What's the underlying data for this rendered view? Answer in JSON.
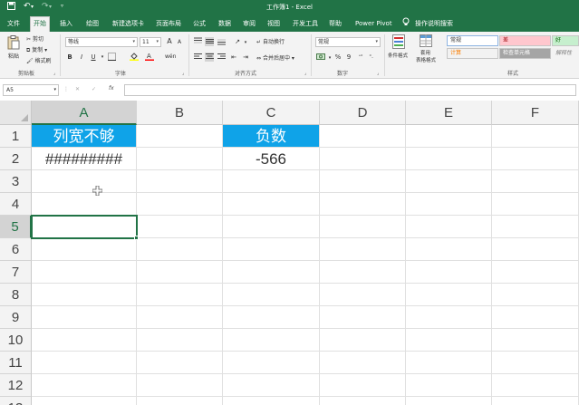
{
  "window": {
    "title": "工作簿1 - Excel",
    "quick_access": [
      "save-icon",
      "undo-icon",
      "redo-icon",
      "customize-icon"
    ]
  },
  "ribbon_tabs": [
    "文件",
    "开始",
    "插入",
    "绘图",
    "新建选项卡",
    "页面布局",
    "公式",
    "数据",
    "审阅",
    "视图",
    "开发工具",
    "帮助",
    "Power Pivot"
  ],
  "active_tab": "开始",
  "tell_me": "操作说明搜索",
  "ribbon": {
    "clipboard": {
      "paste": "粘贴",
      "cut": "剪切",
      "copy": "复制",
      "format_painter": "格式刷",
      "label": "剪贴板"
    },
    "font": {
      "name": "等线",
      "size": "11",
      "grow": "A",
      "shrink": "A",
      "bold": "B",
      "italic": "I",
      "underline": "U",
      "phonetic": "wén",
      "label": "字体"
    },
    "alignment": {
      "wrap_text": "自动换行",
      "merge_center": "合并后居中",
      "label": "对齐方式"
    },
    "number": {
      "format": "常规",
      "percent": "%",
      "comma": "9",
      "label": "数字"
    },
    "styles": {
      "conditional": "条件格式",
      "table_line1": "套用",
      "table_line2": "表格格式",
      "normal": "常规",
      "bad": "差",
      "good": "好",
      "calculation": "计算",
      "check_cell": "检查单元格",
      "explanatory": "解释性",
      "label": "样式",
      "colors": {
        "bad_bg": "#ffc7ce",
        "bad_fg": "#9c0006",
        "good_bg": "#c6efce",
        "good_fg": "#006100",
        "calc_bg": "#f2f2f2",
        "calc_fg": "#fa7d00",
        "check_bg": "#a5a5a5"
      }
    }
  },
  "formula_bar": {
    "name_box": "A5",
    "fx": "fx",
    "cancel": "✕",
    "enter": "✓",
    "value": ""
  },
  "sheet": {
    "columns": [
      "A",
      "B",
      "C",
      "D",
      "E",
      "F"
    ],
    "rows": [
      "1",
      "2",
      "3",
      "4",
      "5",
      "6",
      "7",
      "8",
      "9",
      "10",
      "11",
      "12",
      "13"
    ],
    "selected_cell": "A5",
    "cells": {
      "A1": "列宽不够",
      "C1": "负数",
      "A2": "#########",
      "C2": "-566"
    },
    "header_fill": "#0fa3e8",
    "accent": "#217346"
  }
}
